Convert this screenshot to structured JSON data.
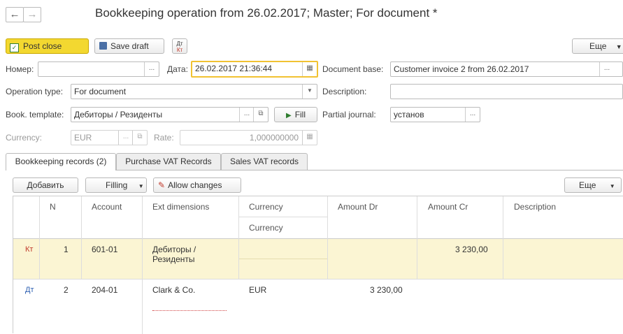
{
  "window": {
    "title": "Bookkeeping operation  from 26.02.2017; Master; For document *",
    "back_icon": "←",
    "forward_icon": "→"
  },
  "toolbar": {
    "post_close": "Post close",
    "save_draft": "Save draft",
    "dtkt_icon_top": "Дт",
    "dtkt_icon_bottom": "Кт",
    "more": "Еще"
  },
  "form": {
    "number_label": "Номер:",
    "number_value": "",
    "date_label": "Дата:",
    "date_value": "26.02.2017 21:36:44",
    "doc_base_label": "Document base:",
    "doc_base_value": "Customer invoice 2 from 26.02.2017",
    "op_type_label": "Operation type:",
    "op_type_value": "For document",
    "description_label": "Description:",
    "description_value": "",
    "template_label": "Book. template:",
    "template_value": "Дебиторы / Резиденты",
    "fill_button": "Fill",
    "partial_journal_label": "Partial journal:",
    "partial_journal_value": "установ",
    "currency_label": "Currency:",
    "currency_value": "EUR",
    "rate_label": "Rate:",
    "rate_value": "1,000000000"
  },
  "tabs": [
    {
      "label": "Bookkeeping records (2)"
    },
    {
      "label": "Purchase VAT Records"
    },
    {
      "label": "Sales VAT records"
    }
  ],
  "grid_toolbar": {
    "add": "Добавить",
    "filling": "Filling",
    "allow_changes": "Allow changes",
    "more": "Еще"
  },
  "grid": {
    "columns": {
      "n": "N",
      "account": "Account",
      "ext_dimensions": "Ext dimensions",
      "currency": "Currency",
      "currency_sub": "Currency",
      "amount_dr": "Amount Dr",
      "amount_cr": "Amount Cr",
      "description": "Description"
    },
    "rows": [
      {
        "type": "Кт",
        "n": "1",
        "account": "601-01",
        "ext_line1": "Дебиторы /",
        "ext_line2": "Резиденты",
        "currency": "",
        "amount_dr": "",
        "amount_cr": "3 230,00",
        "description": ""
      },
      {
        "type": "Дт",
        "n": "2",
        "account": "204-01",
        "ext_line1": "Clark & Co.",
        "ext_line2": "",
        "currency": "EUR",
        "amount_dr": "3 230,00",
        "amount_cr": "",
        "description": ""
      }
    ]
  },
  "colors": {
    "accent_yellow": "#f3d830",
    "selected_row": "#fbf5d3",
    "kt_color": "#c0392b",
    "dt_color": "#2a5db0"
  }
}
